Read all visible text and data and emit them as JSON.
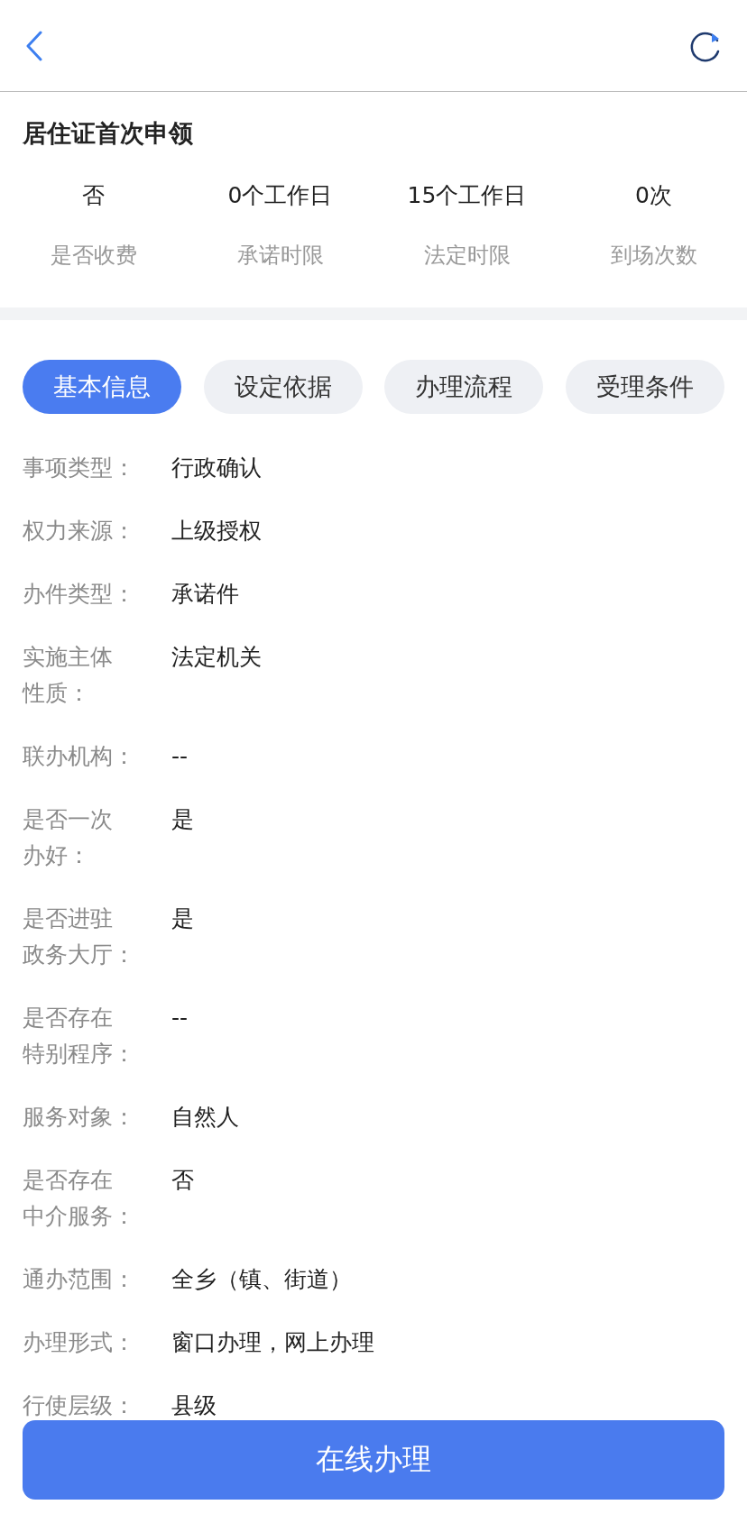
{
  "title": "居住证首次申领",
  "stats": [
    {
      "value": "否",
      "label": "是否收费"
    },
    {
      "value": "0个工作日",
      "label": "承诺时限"
    },
    {
      "value": "15个工作日",
      "label": "法定时限"
    },
    {
      "value": "0次",
      "label": "到场次数"
    }
  ],
  "tabs": [
    {
      "label": "基本信息",
      "selected": true
    },
    {
      "label": "设定依据",
      "selected": false
    },
    {
      "label": "办理流程",
      "selected": false
    },
    {
      "label": "受理条件",
      "selected": false
    }
  ],
  "rows": [
    {
      "label_lines": [
        "事项类型："
      ],
      "value": "行政确认"
    },
    {
      "label_lines": [
        "权力来源："
      ],
      "value": "上级授权"
    },
    {
      "label_lines": [
        "办件类型："
      ],
      "value": "承诺件"
    },
    {
      "label_lines": [
        "实施主体",
        "性质："
      ],
      "value": "法定机关"
    },
    {
      "label_lines": [
        "联办机构："
      ],
      "value": "--"
    },
    {
      "label_lines": [
        "是否一次",
        "办好："
      ],
      "value": "是"
    },
    {
      "label_lines": [
        "是否进驻",
        "政务大厅："
      ],
      "value": "是"
    },
    {
      "label_lines": [
        "是否存在",
        "特别程序："
      ],
      "value": "--"
    },
    {
      "label_lines": [
        "服务对象："
      ],
      "value": "自然人"
    },
    {
      "label_lines": [
        "是否存在",
        "中介服务："
      ],
      "value": "否"
    },
    {
      "label_lines": [
        "通办范围："
      ],
      "value": "全乡（镇、街道）"
    },
    {
      "label_lines": [
        "办理形式："
      ],
      "value": "窗口办理，网上办理"
    },
    {
      "label_lines": [
        "行使层级："
      ],
      "value": "县级"
    }
  ],
  "action_button": "在线办理"
}
